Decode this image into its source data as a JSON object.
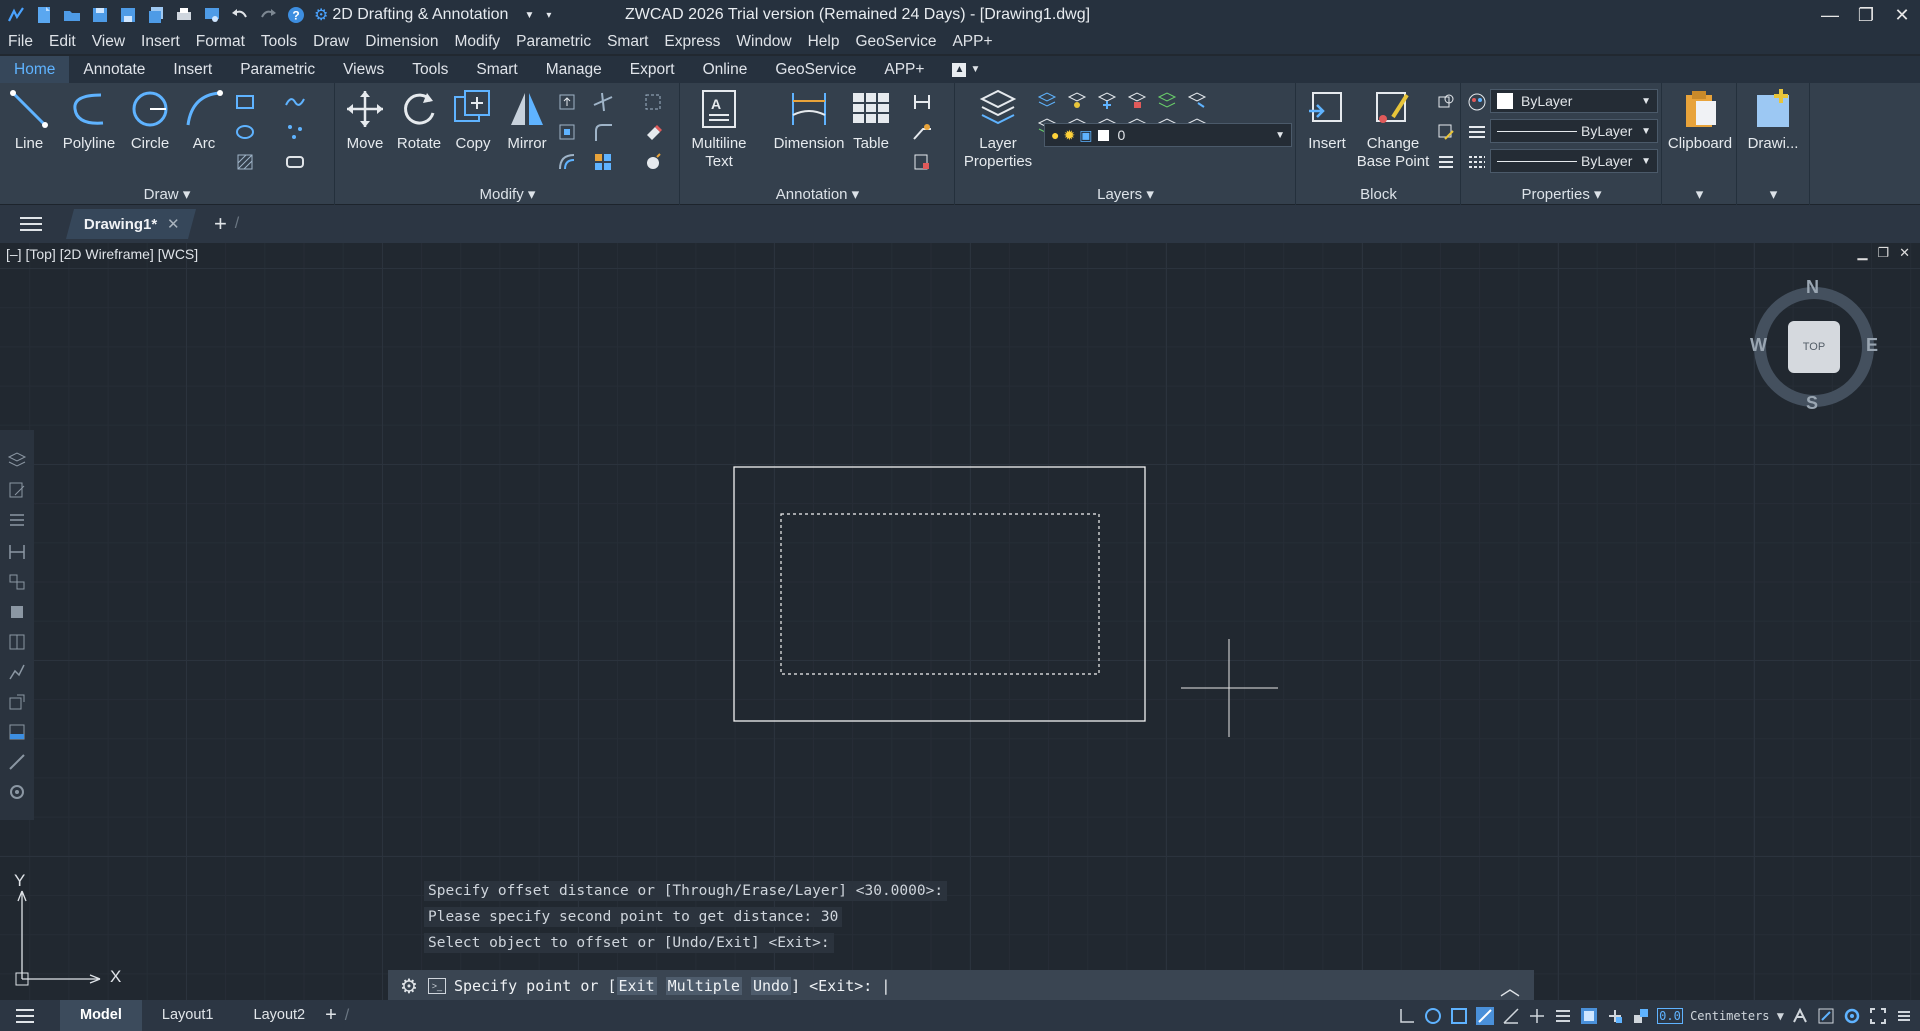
{
  "titlebar": {
    "workspace": "2D Drafting & Annotation",
    "title": "ZWCAD 2026 Trial version (Remained 24 Days) - [Drawing1.dwg]"
  },
  "menu": [
    "File",
    "Edit",
    "View",
    "Insert",
    "Format",
    "Tools",
    "Draw",
    "Dimension",
    "Modify",
    "Parametric",
    "Smart",
    "Express",
    "Window",
    "Help",
    "GeoService",
    "APP+"
  ],
  "ribbon_tabs": [
    "Home",
    "Annotate",
    "Insert",
    "Parametric",
    "Views",
    "Tools",
    "Smart",
    "Manage",
    "Export",
    "Online",
    "GeoService",
    "APP+"
  ],
  "panels": {
    "draw": {
      "label": "Draw",
      "line": "Line",
      "polyline": "Polyline",
      "circle": "Circle",
      "arc": "Arc"
    },
    "modify": {
      "label": "Modify",
      "move": "Move",
      "rotate": "Rotate",
      "copy": "Copy",
      "mirror": "Mirror"
    },
    "annotation": {
      "label": "Annotation",
      "mtext1": "Multiline",
      "mtext2": "Text",
      "dimension": "Dimension",
      "table": "Table"
    },
    "layers": {
      "label": "Layers",
      "props1": "Layer",
      "props2": "Properties",
      "current_layer": "0"
    },
    "block": {
      "label": "Block",
      "insert": "Insert",
      "change1": "Change",
      "change2": "Base Point"
    },
    "properties": {
      "label": "Properties",
      "color": "ByLayer",
      "linetype": "ByLayer",
      "lineweight": "ByLayer"
    },
    "clipboard": {
      "label": "Clipboard"
    },
    "drawing": {
      "label": "Drawi..."
    }
  },
  "doc_tab": "Drawing1*",
  "viewport": {
    "label": "[–] [Top] [2D Wireframe] [WCS]"
  },
  "viewcube": {
    "n": "N",
    "s": "S",
    "e": "E",
    "w": "W",
    "top": "TOP"
  },
  "ucs": {
    "x": "X",
    "y": "Y"
  },
  "command": {
    "history": [
      "Specify offset distance or [Through/Erase/Layer] <30.0000>:",
      "Please specify second point to get distance: 30",
      "Select object to offset or [Undo/Exit] <Exit>:"
    ],
    "prompt_start": "Specify point or [",
    "opt1": "Exit",
    "opt2": "Multiple",
    "opt3": "Undo",
    "prompt_end": "] <Exit>:"
  },
  "layouts": [
    "Model",
    "Layout1",
    "Layout2"
  ],
  "units": "Centimeters",
  "colors": {
    "accent": "#5fb3ff",
    "background": "#212830",
    "ribbon": "#34404d"
  }
}
